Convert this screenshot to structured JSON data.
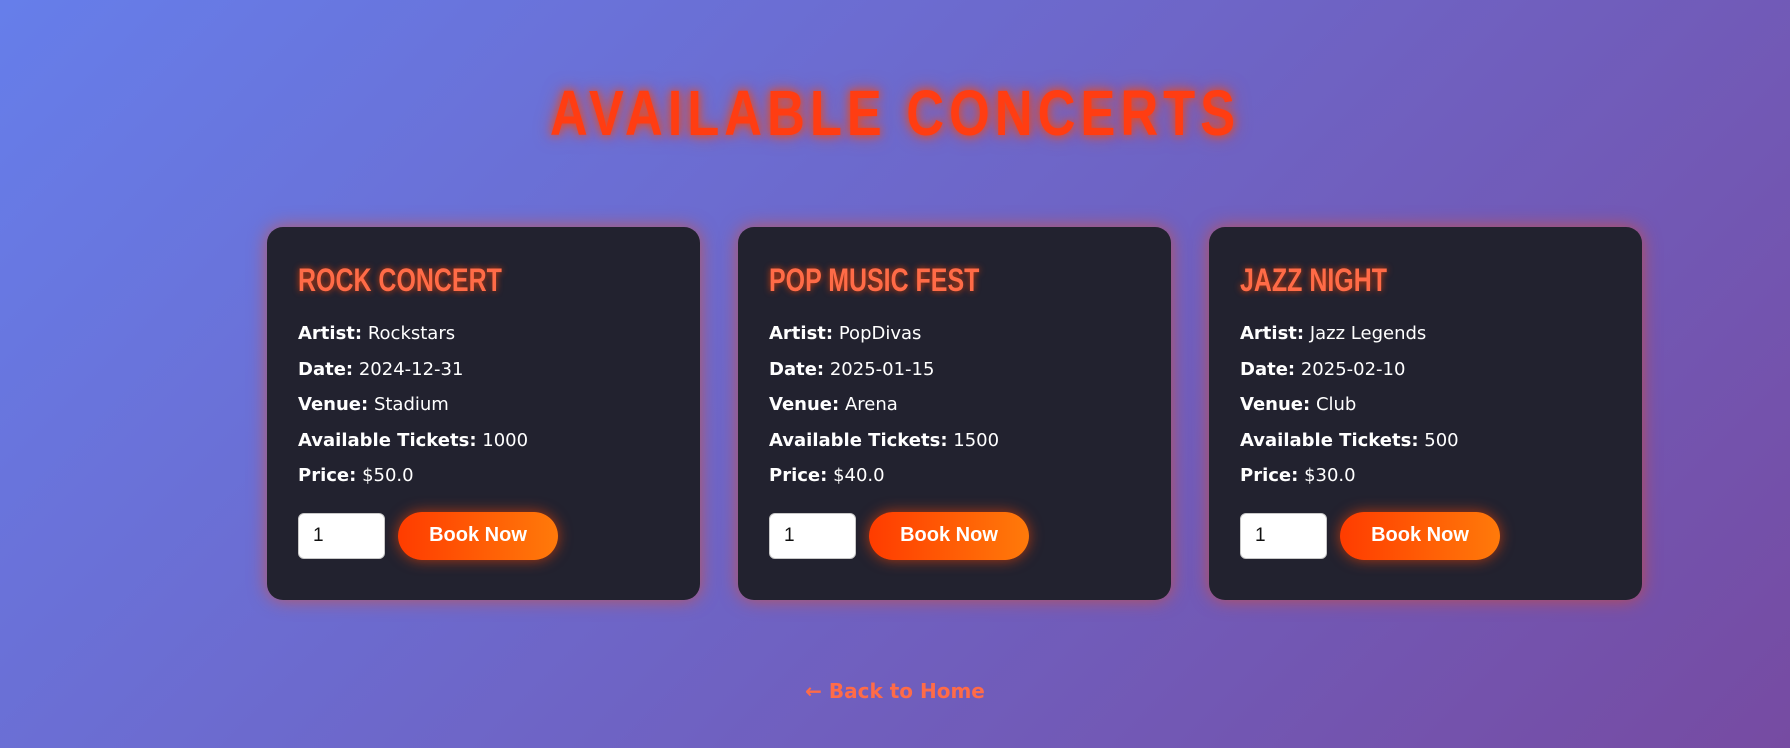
{
  "page": {
    "title": "Available Concerts"
  },
  "labels": {
    "artist": "Artist:",
    "date": "Date:",
    "venue": "Venue:",
    "tickets": "Available Tickets:",
    "price": "Price:"
  },
  "concerts": [
    {
      "name": "Rock Concert",
      "artist": "Rockstars",
      "date": "2024-12-31",
      "venue": "Stadium",
      "tickets": "1000",
      "price": "$50.0",
      "quantity": "1",
      "book_label": "Book Now"
    },
    {
      "name": "Pop Music Fest",
      "artist": "PopDivas",
      "date": "2025-01-15",
      "venue": "Arena",
      "tickets": "1500",
      "price": "$40.0",
      "quantity": "1",
      "book_label": "Book Now"
    },
    {
      "name": "Jazz Night",
      "artist": "Jazz Legends",
      "date": "2025-02-10",
      "venue": "Club",
      "tickets": "500",
      "price": "$30.0",
      "quantity": "1",
      "book_label": "Book Now"
    }
  ],
  "footer": {
    "back_link": "← Back to Home"
  },
  "colors": {
    "background_start": "#667eea",
    "background_end": "#764ba2",
    "card_background": "#22222f",
    "accent": "#ff4500",
    "title": "#ff3d12",
    "card_title": "#ff6b47"
  }
}
